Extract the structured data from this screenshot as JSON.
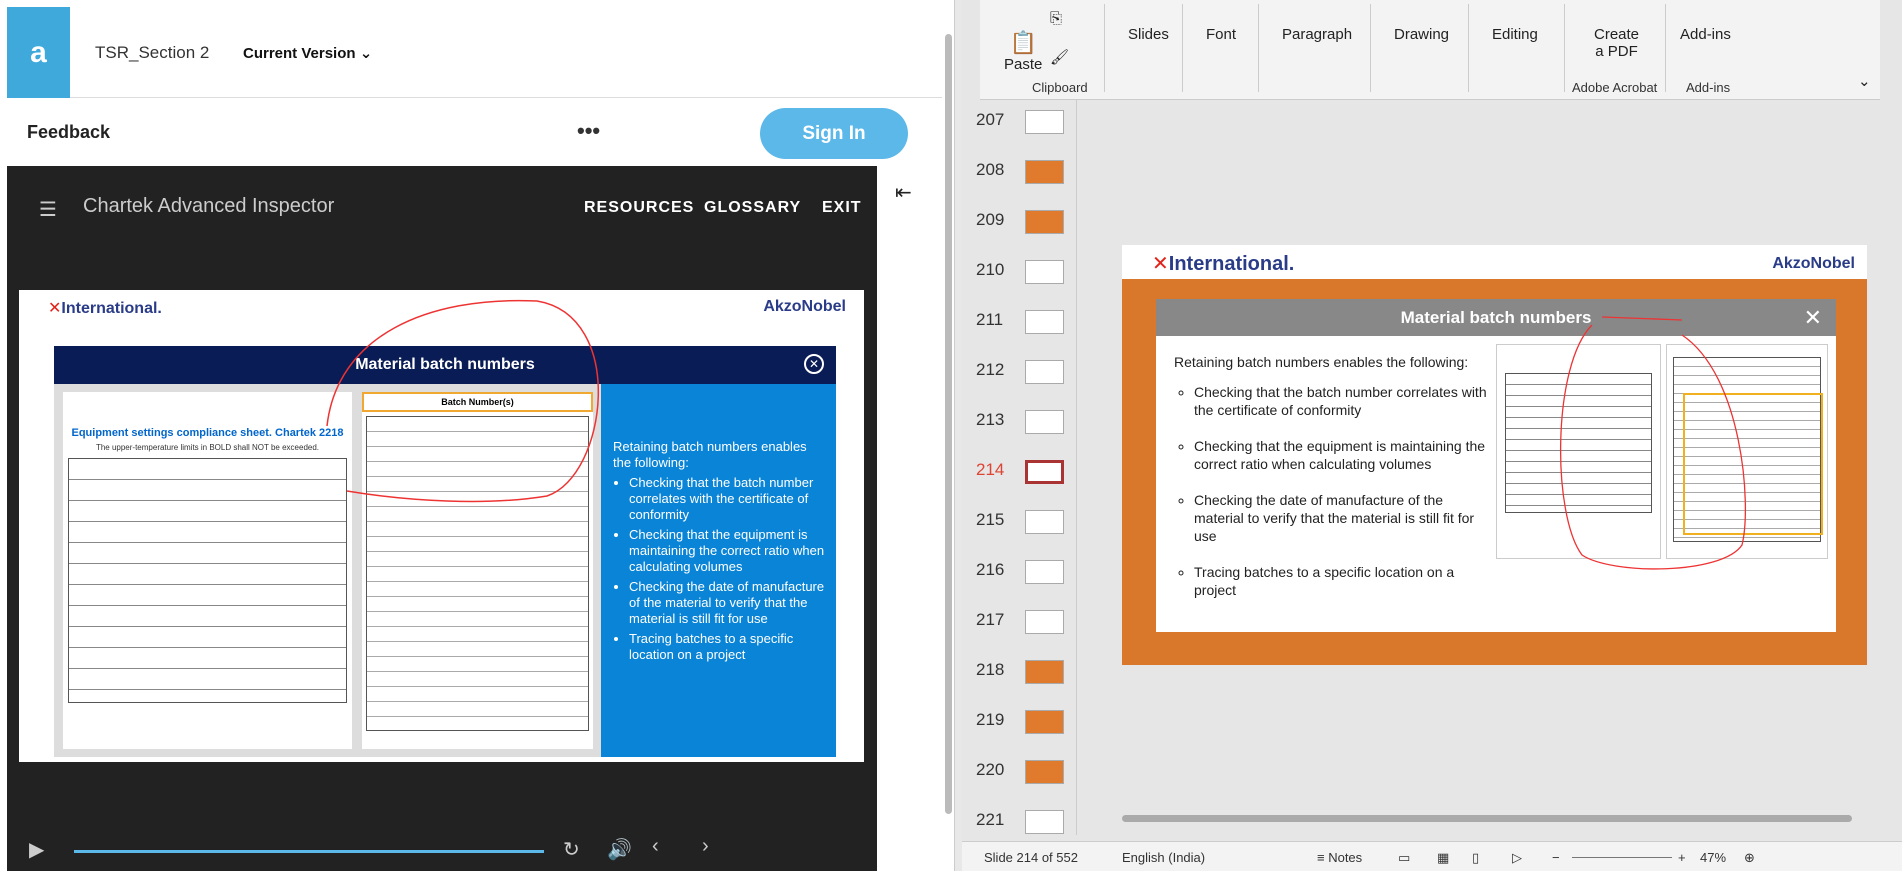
{
  "left": {
    "logo": "a",
    "doc_title": "TSR_Section 2",
    "version": "Current Version",
    "feedback": "Feedback",
    "more": "•••",
    "signin": "Sign In",
    "player_title": "Chartek Advanced Inspector",
    "nav": [
      "RESOURCES",
      "GLOSSARY",
      "EXIT"
    ],
    "slide": {
      "brand_left": "International.",
      "brand_right": "AkzoNobel",
      "title": "Material batch numbers",
      "sheet_title": "Equipment settings compliance sheet. Chartek 2218",
      "sheet_note": "The upper-temperature limits in BOLD shall NOT be exceeded.",
      "batch_header": "Batch Number(s)",
      "intro": "Retaining batch numbers enables the following:",
      "bullets": [
        "Checking that the batch number correlates with the certificate of conformity",
        "Checking that the equipment is maintaining the correct ratio when calculating volumes",
        "Checking the date of manufacture of the material to verify that the material is still fit for use",
        "Tracing batches to a specific location on a project"
      ]
    }
  },
  "ribbon": {
    "paste": "Paste",
    "clipboard": "Clipboard",
    "slides": "Slides",
    "font": "Font",
    "paragraph": "Paragraph",
    "drawing": "Drawing",
    "editing": "Editing",
    "create_pdf_1": "Create",
    "create_pdf_2": "a PDF",
    "adobe": "Adobe Acrobat",
    "addins": "Add-ins",
    "addins_group": "Add-ins"
  },
  "thumbnails": [
    {
      "num": "207",
      "orange": false
    },
    {
      "num": "208",
      "orange": true
    },
    {
      "num": "209",
      "orange": true
    },
    {
      "num": "210",
      "orange": false
    },
    {
      "num": "211",
      "orange": false
    },
    {
      "num": "212",
      "orange": false
    },
    {
      "num": "213",
      "orange": false
    },
    {
      "num": "214",
      "orange": false,
      "current": true
    },
    {
      "num": "215",
      "orange": false
    },
    {
      "num": "216",
      "orange": false
    },
    {
      "num": "217",
      "orange": false
    },
    {
      "num": "218",
      "orange": true
    },
    {
      "num": "219",
      "orange": true
    },
    {
      "num": "220",
      "orange": true
    },
    {
      "num": "221",
      "orange": false
    }
  ],
  "canvas": {
    "brand_left": "International.",
    "brand_right": "AkzoNobel",
    "title": "Material batch numbers",
    "close": "✕",
    "intro": "Retaining batch numbers enables the following:",
    "bullets": [
      "Checking that the batch number correlates with the certificate of conformity",
      "Checking that the equipment is maintaining the correct ratio when calculating volumes",
      "Checking the date of manufacture of the material to verify that the material is still fit for use",
      "Tracing batches to a specific location on a project"
    ]
  },
  "status": {
    "slide": "Slide 214 of 552",
    "language": "English (India)",
    "notes": "Notes",
    "zoom": "47%"
  },
  "colors": {
    "brand_blue": "#2a3c88",
    "orange": "#d9782b",
    "accent": "#5bb8e8"
  }
}
